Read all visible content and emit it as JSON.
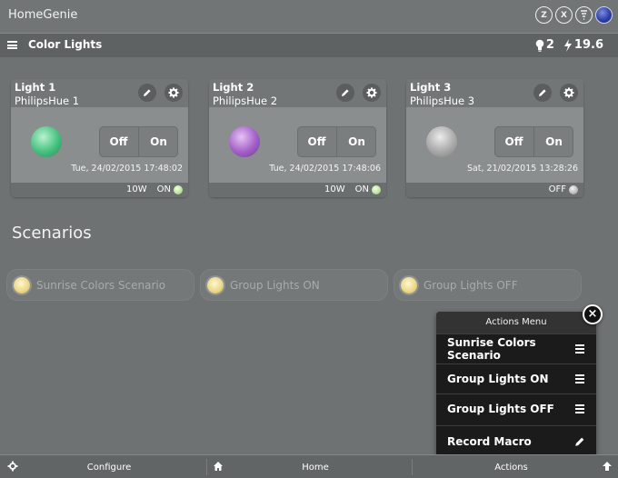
{
  "app": {
    "title": "HomeGenie",
    "status_icons": [
      "zwave-icon",
      "x10-icon",
      "network-icon",
      "globe-icon"
    ],
    "status_letters": [
      "Z",
      "X"
    ]
  },
  "header": {
    "title": "Color Lights",
    "lights_on_count": "2",
    "power_usage": "19.6"
  },
  "lights": [
    {
      "name": "Light 1",
      "subtitle": "PhilipsHue 1",
      "off_label": "Off",
      "on_label": "On",
      "timestamp": "Tue, 24/02/2015 17:48:02",
      "watts": "10W",
      "state": "ON",
      "color": "#45c07f"
    },
    {
      "name": "Light 2",
      "subtitle": "PhilipsHue 2",
      "off_label": "Off",
      "on_label": "On",
      "timestamp": "Tue, 24/02/2015 17:48:06",
      "watts": "10W",
      "state": "ON",
      "color": "#a35fc9"
    },
    {
      "name": "Light 3",
      "subtitle": "PhilipsHue 3",
      "off_label": "Off",
      "on_label": "On",
      "timestamp": "Sat, 21/02/2015 13:28:26",
      "watts": "",
      "state": "OFF",
      "color": "#b5b5b5"
    }
  ],
  "scenarios": {
    "title": "Scenarios",
    "items": [
      "Sunrise Colors Scenario",
      "Group Lights ON",
      "Group Lights OFF"
    ]
  },
  "actions_menu": {
    "title": "Actions Menu",
    "close_glyph": "×",
    "items": [
      {
        "label": "Sunrise Colors Scenario",
        "icon": "menu-icon"
      },
      {
        "label": "Group Lights ON",
        "icon": "menu-icon"
      },
      {
        "label": "Group Lights OFF",
        "icon": "menu-icon"
      },
      {
        "label": "Record Macro",
        "icon": "pencil-icon"
      }
    ]
  },
  "bottom_bar": {
    "configure": "Configure",
    "home": "Home",
    "actions": "Actions"
  }
}
